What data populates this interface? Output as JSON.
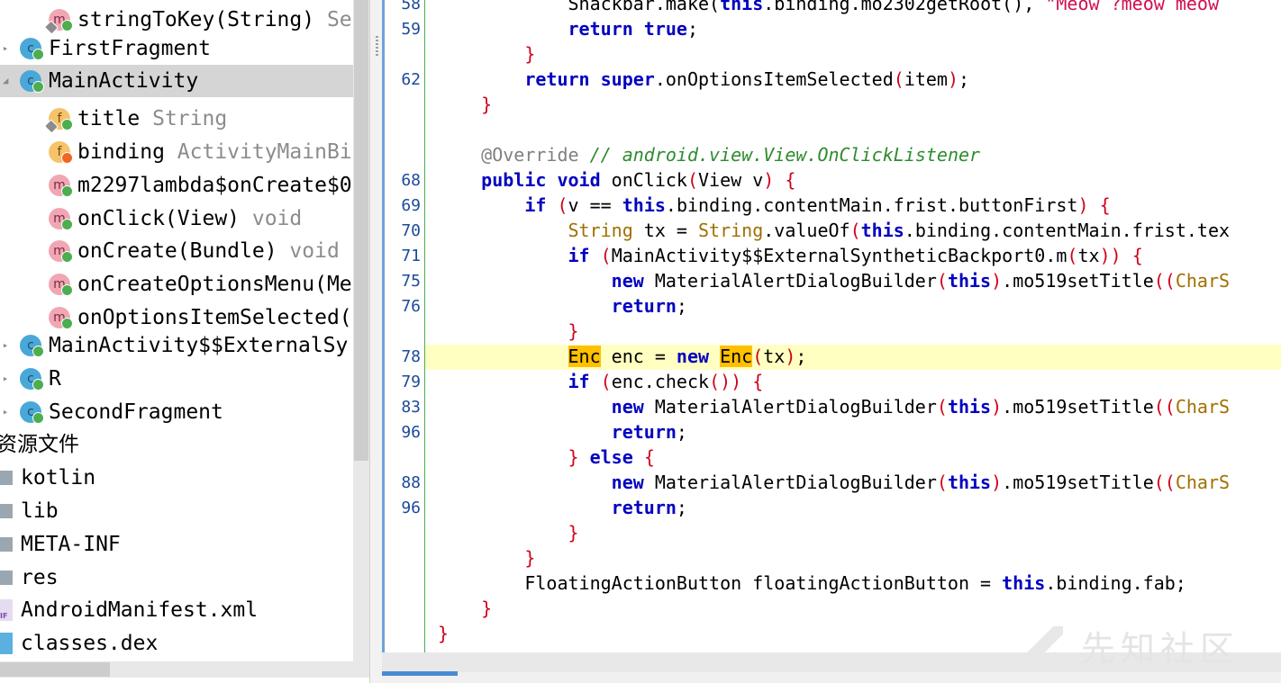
{
  "tree": {
    "items": [
      {
        "kind": "method",
        "label": "stringToKey(String)",
        "type": "Se",
        "badge": "locked"
      },
      {
        "kind": "class",
        "label": "FirstFragment",
        "expand": "collapsed"
      },
      {
        "kind": "class",
        "label": "MainActivity",
        "expand": "expanded",
        "selected": true
      },
      {
        "kind": "field",
        "label": "title",
        "type": "String",
        "badge": "locked"
      },
      {
        "kind": "field",
        "label": "binding",
        "type": "ActivityMainBi",
        "badge": "orange"
      },
      {
        "kind": "method",
        "label": "m2297lambda$onCreate$0",
        "type": ""
      },
      {
        "kind": "method",
        "label": "onClick(View)",
        "type": "void"
      },
      {
        "kind": "method",
        "label": "onCreate(Bundle)",
        "type": "void"
      },
      {
        "kind": "method",
        "label": "onCreateOptionsMenu(Me",
        "type": ""
      },
      {
        "kind": "method",
        "label": "onOptionsItemSelected(",
        "type": ""
      },
      {
        "kind": "class",
        "label": "MainActivity$$ExternalSy",
        "expand": "collapsed"
      },
      {
        "kind": "class",
        "label": "R",
        "expand": "collapsed"
      },
      {
        "kind": "class",
        "label": "SecondFragment",
        "expand": "collapsed"
      }
    ],
    "section_label": "资源文件",
    "files": [
      {
        "kind": "folder",
        "label": "kotlin"
      },
      {
        "kind": "folder",
        "label": "lib"
      },
      {
        "kind": "folder",
        "label": "META-INF"
      },
      {
        "kind": "folder",
        "label": "res"
      },
      {
        "kind": "manifest",
        "label": "AndroidManifest.xml",
        "tag": "IF"
      },
      {
        "kind": "dex",
        "label": "classes.dex"
      }
    ]
  },
  "editor": {
    "lines": [
      {
        "num": "58",
        "parts": [
          [
            "",
            "            Snackbar.make("
          ],
          [
            "kw",
            "this"
          ],
          [
            "",
            ".binding.mo2302getRoot(), "
          ],
          [
            "str",
            "\"Meow ?meow meow"
          ]
        ]
      },
      {
        "num": "59",
        "parts": [
          [
            "",
            "            "
          ],
          [
            "kw",
            "return true"
          ],
          [
            "",
            ";"
          ]
        ]
      },
      {
        "num": "",
        "parts": [
          [
            "",
            "        "
          ],
          [
            "brk",
            "}"
          ]
        ]
      },
      {
        "num": "62",
        "parts": [
          [
            "",
            "        "
          ],
          [
            "kw",
            "return super"
          ],
          [
            "",
            ".onOptionsItemSelected"
          ],
          [
            "brk",
            "("
          ],
          [
            "",
            "item"
          ],
          [
            "brk",
            ")"
          ],
          [
            "",
            ";"
          ]
        ]
      },
      {
        "num": "",
        "parts": [
          [
            "",
            "    "
          ],
          [
            "brk",
            "}"
          ]
        ]
      },
      {
        "num": "",
        "parts": []
      },
      {
        "num": "",
        "parts": [
          [
            "",
            "    "
          ],
          [
            "ann",
            "@Override"
          ],
          [
            "",
            " "
          ],
          [
            "cmt",
            "// android.view.View.OnClickListener"
          ]
        ]
      },
      {
        "num": "68",
        "parts": [
          [
            "",
            "    "
          ],
          [
            "kw",
            "public void"
          ],
          [
            "",
            " onClick"
          ],
          [
            "brk",
            "("
          ],
          [
            "",
            "View v"
          ],
          [
            "brk",
            ")"
          ],
          [
            "",
            " "
          ],
          [
            "brk",
            "{"
          ]
        ]
      },
      {
        "num": "69",
        "parts": [
          [
            "",
            "        "
          ],
          [
            "kw",
            "if"
          ],
          [
            "",
            " "
          ],
          [
            "brk",
            "("
          ],
          [
            "",
            "v == "
          ],
          [
            "kw",
            "this"
          ],
          [
            "",
            ".binding.contentMain.frist.buttonFirst"
          ],
          [
            "brk",
            ")"
          ],
          [
            "",
            " "
          ],
          [
            "brk",
            "{"
          ]
        ]
      },
      {
        "num": "70",
        "parts": [
          [
            "",
            "            "
          ],
          [
            "cls",
            "String"
          ],
          [
            "",
            " tx = "
          ],
          [
            "cls",
            "String"
          ],
          [
            "",
            ".valueOf"
          ],
          [
            "brk",
            "("
          ],
          [
            "kw",
            "this"
          ],
          [
            "",
            ".binding.contentMain.frist.tex"
          ]
        ]
      },
      {
        "num": "71",
        "parts": [
          [
            "",
            "            "
          ],
          [
            "kw",
            "if"
          ],
          [
            "",
            " "
          ],
          [
            "brk",
            "("
          ],
          [
            "",
            "MainActivity$$ExternalSyntheticBackport0.m"
          ],
          [
            "brk",
            "("
          ],
          [
            "",
            "tx"
          ],
          [
            "brk",
            "))"
          ],
          [
            "",
            " "
          ],
          [
            "brk",
            "{"
          ]
        ]
      },
      {
        "num": "75",
        "parts": [
          [
            "",
            "                "
          ],
          [
            "kw",
            "new"
          ],
          [
            "",
            " MaterialAlertDialogBuilder"
          ],
          [
            "brk",
            "("
          ],
          [
            "kw",
            "this"
          ],
          [
            "brk",
            ")"
          ],
          [
            "",
            ".mo519setTitle"
          ],
          [
            "brk",
            "(("
          ],
          [
            "cls",
            "CharS"
          ]
        ]
      },
      {
        "num": "76",
        "parts": [
          [
            "",
            "                "
          ],
          [
            "kw",
            "return"
          ],
          [
            "",
            ";"
          ]
        ]
      },
      {
        "num": "",
        "parts": [
          [
            "",
            "            "
          ],
          [
            "brk",
            "}"
          ]
        ]
      },
      {
        "num": "78",
        "parts": [
          [
            "",
            "            "
          ],
          [
            "hl",
            "Enc"
          ],
          [
            "",
            " enc = "
          ],
          [
            "kw",
            "new"
          ],
          [
            "",
            " "
          ],
          [
            "hl",
            "Enc"
          ],
          [
            "brk",
            "("
          ],
          [
            "",
            "tx"
          ],
          [
            "brk",
            ")"
          ],
          [
            "",
            ";"
          ]
        ]
      },
      {
        "num": "79",
        "parts": [
          [
            "",
            "            "
          ],
          [
            "kw",
            "if"
          ],
          [
            "",
            " "
          ],
          [
            "brk",
            "("
          ],
          [
            "",
            "enc.check"
          ],
          [
            "brk",
            "())"
          ],
          [
            "",
            " "
          ],
          [
            "brk",
            "{"
          ]
        ]
      },
      {
        "num": "83",
        "parts": [
          [
            "",
            "                "
          ],
          [
            "kw",
            "new"
          ],
          [
            "",
            " MaterialAlertDialogBuilder"
          ],
          [
            "brk",
            "("
          ],
          [
            "kw",
            "this"
          ],
          [
            "brk",
            ")"
          ],
          [
            "",
            ".mo519setTitle"
          ],
          [
            "brk",
            "(("
          ],
          [
            "cls",
            "CharS"
          ]
        ]
      },
      {
        "num": "96",
        "parts": [
          [
            "",
            "                "
          ],
          [
            "kw",
            "return"
          ],
          [
            "",
            ";"
          ]
        ]
      },
      {
        "num": "",
        "parts": [
          [
            "",
            "            "
          ],
          [
            "brk",
            "}"
          ],
          [
            "",
            " "
          ],
          [
            "kw",
            "else"
          ],
          [
            "",
            " "
          ],
          [
            "brk",
            "{"
          ]
        ]
      },
      {
        "num": "88",
        "parts": [
          [
            "",
            "                "
          ],
          [
            "kw",
            "new"
          ],
          [
            "",
            " MaterialAlertDialogBuilder"
          ],
          [
            "brk",
            "("
          ],
          [
            "kw",
            "this"
          ],
          [
            "brk",
            ")"
          ],
          [
            "",
            ".mo519setTitle"
          ],
          [
            "brk",
            "(("
          ],
          [
            "cls",
            "CharS"
          ]
        ]
      },
      {
        "num": "96",
        "parts": [
          [
            "",
            "                "
          ],
          [
            "kw",
            "return"
          ],
          [
            "",
            ";"
          ]
        ]
      },
      {
        "num": "",
        "parts": [
          [
            "",
            "            "
          ],
          [
            "brk",
            "}"
          ]
        ]
      },
      {
        "num": "",
        "parts": [
          [
            "",
            "        "
          ],
          [
            "brk",
            "}"
          ]
        ]
      },
      {
        "num": "",
        "parts": [
          [
            "",
            "        FloatingActionButton floatingActionButton = "
          ],
          [
            "kw",
            "this"
          ],
          [
            "",
            ".binding.fab;"
          ]
        ]
      },
      {
        "num": "",
        "parts": [
          [
            "",
            "    "
          ],
          [
            "brk",
            "}"
          ]
        ]
      },
      {
        "num": "",
        "parts": [
          [
            "brk",
            "}"
          ]
        ]
      }
    ]
  },
  "watermark": {
    "text": "先知社区"
  },
  "colors": {
    "accent": "#4a8ad4",
    "caret_line": "#ffffc2",
    "highlight": "#ffc000",
    "keyword": "#0000c0",
    "string": "#d01050"
  }
}
